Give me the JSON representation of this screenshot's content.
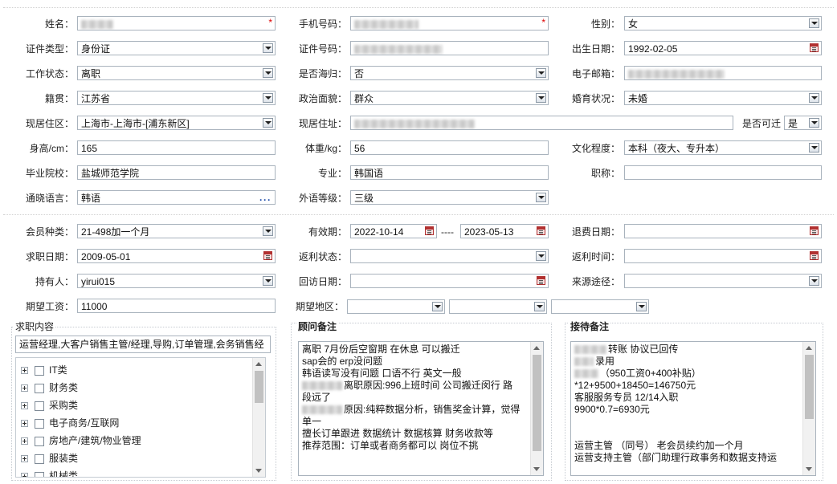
{
  "personal": {
    "name_label": "姓名：",
    "phone_label": "手机号码：",
    "gender_label": "性别：",
    "gender_value": "女",
    "id_type_label": "证件类型：",
    "id_type_value": "身份证",
    "id_no_label": "证件号码：",
    "birth_label": "出生日期：",
    "birth_value": "1992-02-05",
    "work_status_label": "工作状态：",
    "work_status_value": "离职",
    "overseas_label": "是否海归：",
    "overseas_value": "否",
    "email_label": "电子邮箱：",
    "native_label": "籍贯：",
    "native_value": "江苏省",
    "political_label": "政治面貌：",
    "political_value": "群众",
    "marital_label": "婚育状况：",
    "marital_value": "未婚",
    "region_label": "现居住区：",
    "region_value": "上海市-上海市-[浦东新区]",
    "address_label": "现居住址：",
    "relocate_label": "是否可迁",
    "relocate_value": "是",
    "height_label": "身高/cm：",
    "height_value": "165",
    "weight_label": "体重/kg：",
    "weight_value": "56",
    "education_label": "文化程度：",
    "education_value": "本科（夜大、专升本）",
    "school_label": "毕业院校：",
    "school_value": "盐城师范学院",
    "major_label": "专业：",
    "major_value": "韩国语",
    "title_label": "职称：",
    "title_value": "",
    "language_label": "通晓语言：",
    "language_value": "韩语",
    "lang_level_label": "外语等级：",
    "lang_level_value": "三级"
  },
  "membership": {
    "type_label": "会员种类：",
    "type_value": "21-498加一个月",
    "valid_label": "有效期：",
    "valid_from": "2022-10-14",
    "valid_sep": "----",
    "valid_to": "2023-05-13",
    "refund_date_label": "退费日期：",
    "jobseek_date_label": "求职日期：",
    "jobseek_date_value": "2009-05-01",
    "rebate_status_label": "返利状态：",
    "rebate_time_label": "返利时间：",
    "holder_label": "持有人：",
    "holder_value": "yirui015",
    "visit_date_label": "回访日期：",
    "source_label": "来源途径：",
    "salary_label": "期望工资：",
    "salary_value": "11000",
    "area_label": "期望地区："
  },
  "job_content": {
    "legend": "求职内容",
    "summary": "运营经理,大客户销售主管/经理,导购,订单管理,会务销售经",
    "categories": [
      "IT类",
      "财务类",
      "采购类",
      "电子商务/互联网",
      "房地产/建筑/物业管理",
      "服装类",
      "机械类"
    ]
  },
  "consultant_notes": {
    "legend": "顾问备注",
    "lines": [
      "离职 7月份后空窗期 在休息 可以搬迁",
      "sap会的 erp没问题",
      "韩语读写没有问题 口语不行 英文一般",
      "离职原因:996上班时间 公司搬迁闵行 路",
      "段远了",
      "原因:纯粹数据分析，销售奖金计算，觉得",
      "单一",
      "擅长订单跟进 数据统计 数据核算 财务收款等",
      "推荐范围：订单或者商务都可以 岗位不挑"
    ]
  },
  "reception_notes": {
    "legend": "接待备注",
    "lines": [
      "转账 协议已回传",
      "录用",
      "（950工资0+400补贴）",
      "*12+9500+18450=146750元",
      "客服服务专员 12/14入职",
      "9900*0.7=6930元",
      "",
      "",
      "运营主管 （同号） 老会员续约加一个月",
      "运营支持主管（部门助理行政事务和数据支持运"
    ]
  }
}
